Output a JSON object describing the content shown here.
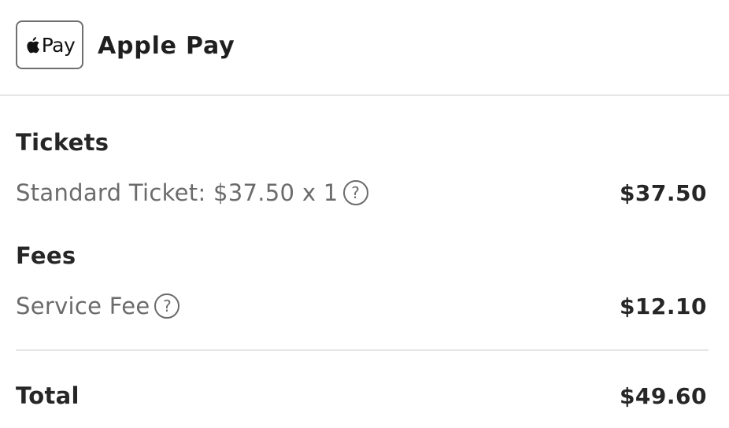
{
  "payment": {
    "badge_text": "Pay",
    "badge_icon": "apple-logo-icon",
    "label": "Apple Pay"
  },
  "tickets": {
    "heading": "Tickets",
    "items": [
      {
        "label": "Standard Ticket: $37.50 x 1",
        "help_icon": "question-circle-icon",
        "help_glyph": "?",
        "amount": "$37.50"
      }
    ]
  },
  "fees": {
    "heading": "Fees",
    "items": [
      {
        "label": "Service Fee",
        "help_icon": "question-circle-icon",
        "help_glyph": "?",
        "amount": "$12.10"
      }
    ]
  },
  "total": {
    "label": "Total",
    "amount": "$49.60"
  }
}
